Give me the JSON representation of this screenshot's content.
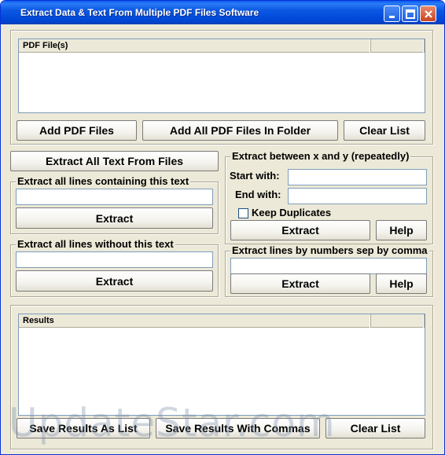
{
  "window": {
    "title": "Extract Data & Text From Multiple PDF Files Software"
  },
  "files": {
    "column_header": "PDF File(s)",
    "add_files": "Add PDF Files",
    "add_folder": "Add All PDF Files In Folder",
    "clear": "Clear List"
  },
  "extract_all": {
    "button": "Extract All Text From Files"
  },
  "containing": {
    "label": "Extract all lines containing this text",
    "value": "",
    "button": "Extract"
  },
  "without": {
    "label": "Extract all lines without this text",
    "value": "",
    "button": "Extract"
  },
  "between": {
    "label": "Extract between x and y (repeatedly)",
    "start_label": "Start with:",
    "start_value": "",
    "end_label": "End with:",
    "end_value": "",
    "keep_duplicates": "Keep Duplicates",
    "keep_duplicates_checked": false,
    "extract": "Extract",
    "help": "Help"
  },
  "by_numbers": {
    "label": "Extract lines by numbers sep by comma",
    "value": "",
    "extract": "Extract",
    "help": "Help"
  },
  "results": {
    "column_header": "Results",
    "save_list": "Save Results As List",
    "save_commas": "Save Results With Commas",
    "clear": "Clear List"
  },
  "watermark": "UpdateStar.com"
}
